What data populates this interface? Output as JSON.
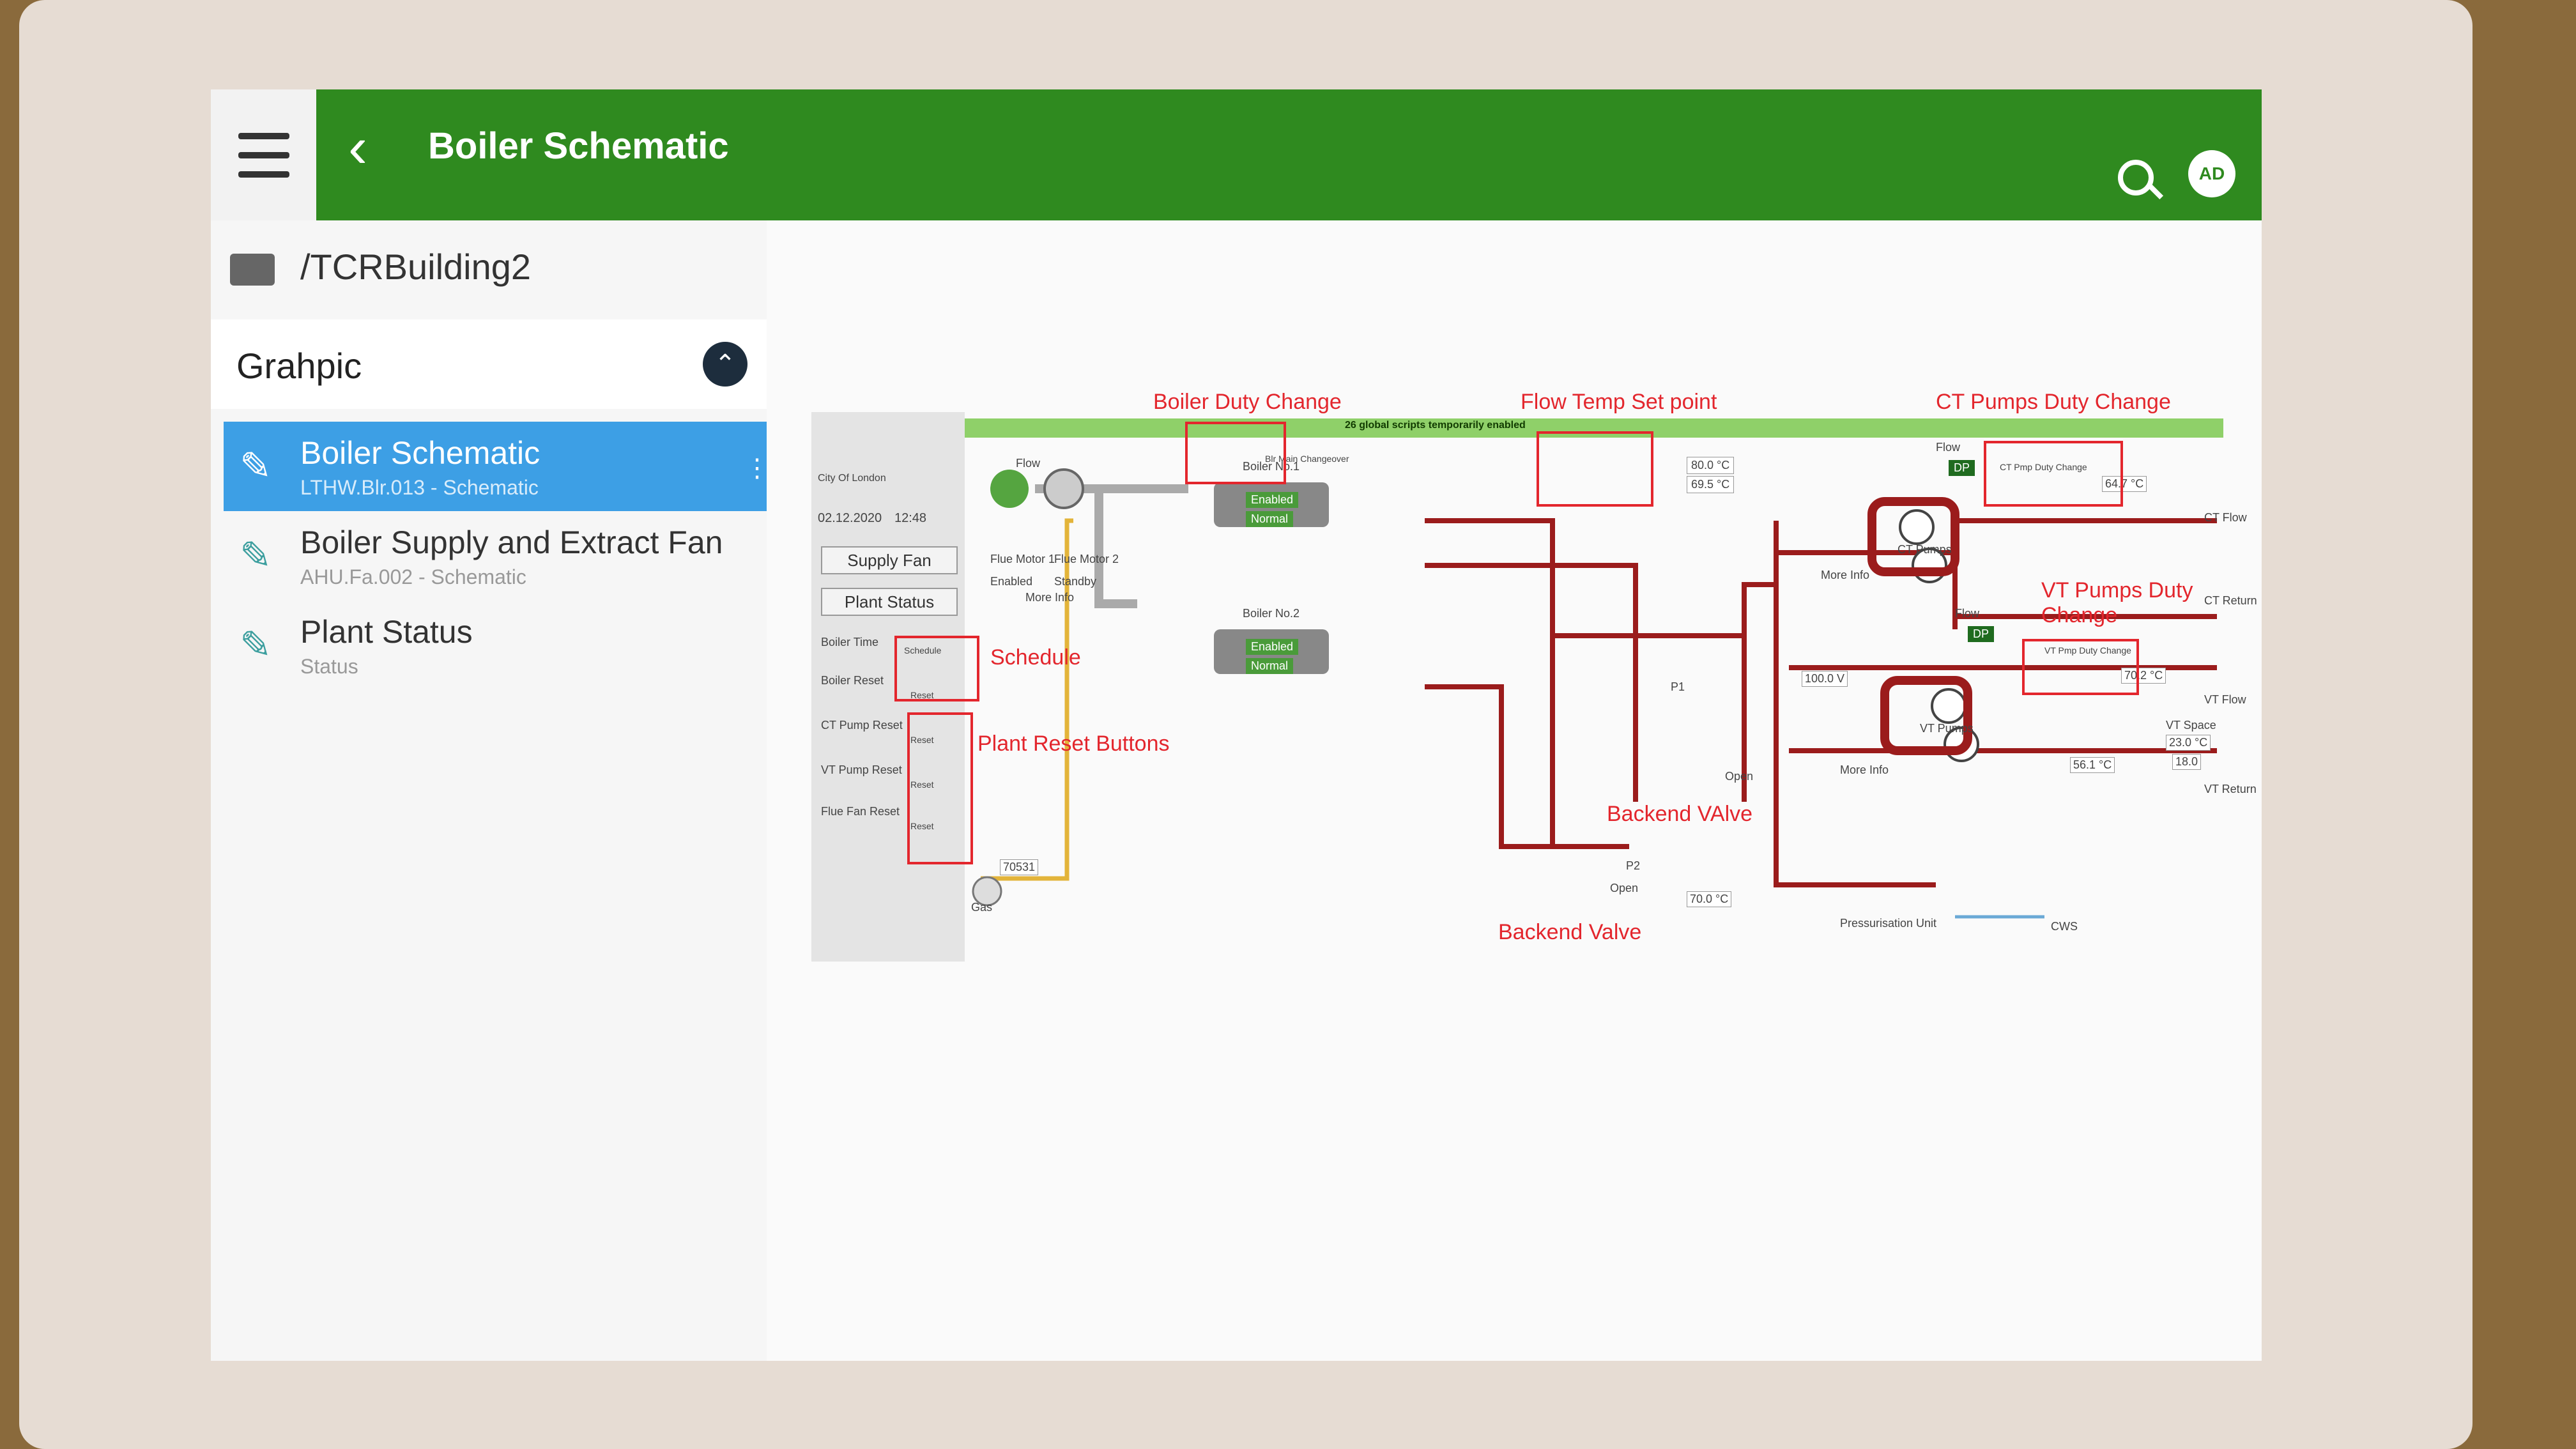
{
  "header": {
    "title": "Boiler Schematic",
    "back_icon": "chevron-left-icon",
    "avatar": "AD"
  },
  "sidebar": {
    "path": "/TCRBuilding2",
    "section": "Grahpic",
    "items": [
      {
        "title": "Boiler Schematic",
        "subtitle": "LTHW.Blr.013 - Schematic"
      },
      {
        "title": "Boiler Supply and Extract Fan",
        "subtitle": "AHU.Fa.002 - Schematic"
      },
      {
        "title": "Plant Status",
        "subtitle": "Status"
      }
    ]
  },
  "schematic": {
    "city": "City Of London",
    "date": "02.12.2020",
    "time": "12:48",
    "supply_fan_btn": "Supply Fan",
    "plant_status_btn": "Plant Status",
    "boiler_time": "Boiler Time",
    "schedule": "Schedule",
    "boiler_reset": "Boiler Reset",
    "ct_pump_reset": "CT Pump Reset",
    "vt_pump_reset": "VT Pump Reset",
    "flue_fan_reset": "Flue Fan Reset",
    "reset": "Reset",
    "banner": "26 global scripts temporarily enabled",
    "boiler1": "Boiler No.1",
    "boiler2": "Boiler No.2",
    "enabled": "Enabled",
    "normal": "Normal",
    "standby": "Standby",
    "flow": "Flow",
    "dp": "DP",
    "flue_motor_1": "Flue Motor 1",
    "flue_motor_2": "Flue Motor 2",
    "more_info": "More Info",
    "ct_pumps": "CT Pumps",
    "vt_pumps": "VT Pumps",
    "ct_flow": "CT Flow",
    "ct_return": "CT Return",
    "vt_flow": "VT Flow",
    "vt_return": "VT Return",
    "vt_space": "VT Space",
    "gas": "Gas",
    "gas_meter": "70531",
    "temp_flow_sp": "80.0 °C",
    "temp_flow_act": "69.5 °C",
    "temp_ct": "64.7 °C",
    "temp_vt": "70.2 °C",
    "temp_100": "100.0 V",
    "temp_back": "70.0 °C",
    "temp_vt_space": "23.0 °C",
    "temp_vt_space2": "18.0",
    "temp_56": "56.1 °C",
    "pressurisation": "Pressurisation Unit",
    "cws": "CWS",
    "open": "Open",
    "p1": "P1",
    "p2": "P2",
    "blr_duty_change": "Blr Main Changeover",
    "ct_duty_change": "CT Pmp Duty Change",
    "vt_duty_change": "VT Pmp Duty Change"
  },
  "annotations": {
    "boiler_duty": "Boiler Duty Change",
    "flow_temp": "Flow Temp Set point",
    "ct_pumps_duty": "CT Pumps Duty Change",
    "vt_pumps_duty": "VT Pumps Duty Change",
    "schedule": "Schedule",
    "plant_reset": "Plant Reset Buttons",
    "backend_valve_1": "Backend VAlve",
    "backend_valve_2": "Backend Valve"
  },
  "colors": {
    "brand": "#2f8a1f",
    "selected": "#3d9fe5",
    "annotation": "#e3262d",
    "pipe": "#9b1c1c"
  }
}
